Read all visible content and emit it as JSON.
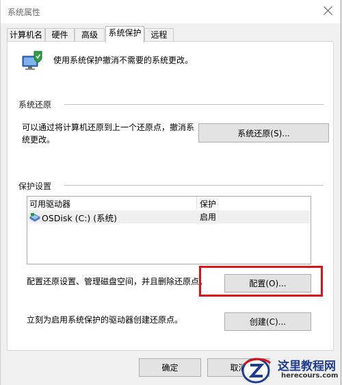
{
  "window": {
    "title": "系统属性"
  },
  "tabs": [
    {
      "label": "计算机名",
      "active": false
    },
    {
      "label": "硬件",
      "active": false
    },
    {
      "label": "高级",
      "active": false
    },
    {
      "label": "系统保护",
      "active": true
    },
    {
      "label": "远程",
      "active": false
    }
  ],
  "intro": {
    "text": "使用系统保护撤消不需要的系统更改。",
    "icon": "system-protection-icon"
  },
  "restore_section": {
    "heading": "系统还原",
    "description_line1": "可以通过将计算机还原到上一个还原点，撤消系",
    "description_line2": "统更改。",
    "button_label": "系统还原(S)..."
  },
  "protection_section": {
    "heading": "保护设置",
    "columns": [
      "可用驱动器",
      "保护"
    ],
    "drives": [
      {
        "name": "OSDisk (C:) (系统)",
        "protection": "启用",
        "icon": "drive-icon"
      }
    ],
    "configure_description": "配置还原设置、管理磁盘空间，并且删除还原点。",
    "configure_button": "配置(O)...",
    "create_description": "立刻为启用系统保护的驱动器创建还原点。",
    "create_button": "创建(C)..."
  },
  "footer": {
    "ok_label": "确定",
    "cancel_label": "取消"
  },
  "watermark": {
    "name": "这里教程网",
    "url": "herecours.com"
  },
  "colors": {
    "highlight_border": "#d7131a",
    "watermark_blue": "#1f3d8f",
    "watermark_red": "#d7131a"
  }
}
